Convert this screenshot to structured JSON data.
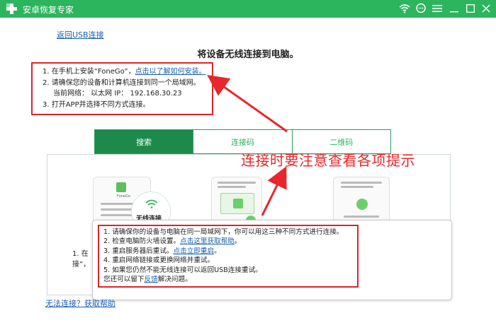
{
  "window": {
    "title": "安卓恢复专家",
    "controls": [
      "wifi-icon",
      "chat-icon",
      "menu-icon",
      "minimize-icon",
      "maximize-icon",
      "close-icon"
    ]
  },
  "back_link": "返回USB连接",
  "heading": "将设备无线连接到电脑。",
  "steps": {
    "s1_prefix": "1.  在手机上安装“FoneGo”，",
    "s1_link": "点击以了解如何安装。",
    "s2": "2.  请确保您的设备和计算机连接到同一个局域网。",
    "s2_net": "当前网络：  以太网     IP：  192.168.30.23",
    "s3": "3.  打开APP并选择不同方式连接。"
  },
  "tabs": [
    {
      "label": "搜索",
      "active": true
    },
    {
      "label": "连接码",
      "active": false
    },
    {
      "label": "二维码",
      "active": false
    }
  ],
  "card": {
    "app_name": "FoneGo",
    "wireless_label": "无线连接",
    "text_line1": "1. 在",
    "text_line2": "接”，"
  },
  "tooltip": {
    "l1": "1.  请确保你的设备与电脑在同一局域网下，你可以用这三种不同方式进行连接。",
    "l2_prefix": "2.  检查电脑防火墙设置。",
    "l2_link": "点击这里获取帮助",
    "l2_suffix": "。",
    "l3_prefix": "3.  重启服务器后重试。",
    "l3_link": "点击立即重启",
    "l3_suffix": "。",
    "l4": "4.  重启网络链接或更换网络并重试。",
    "l5": "5.  如果您仍然不能无线连接可以返回USB连接重试。",
    "l6_prefix": "您还可以留下",
    "l6_link": "反馈",
    "l6_suffix": "解决问题。"
  },
  "help_link": "无法连接？获取帮助",
  "annotation": "连接时要注意查看各项提示",
  "colors": {
    "brand_green": "#2db55d",
    "active_tab": "#1d8a4c",
    "annotation_red": "#e8262b",
    "link_blue": "#1a5fb4"
  }
}
